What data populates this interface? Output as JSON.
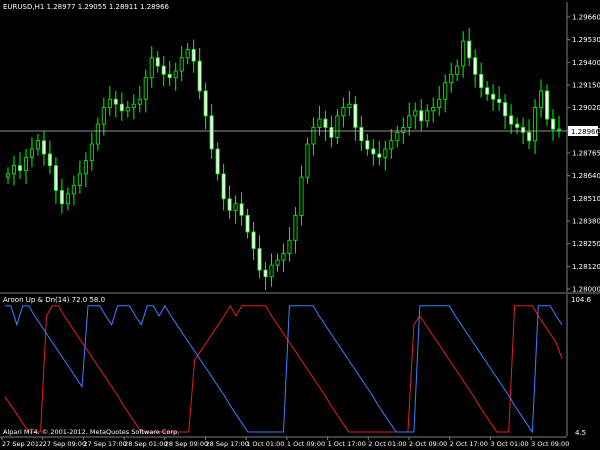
{
  "header": {
    "symbol_info": "EURUSD,H1  1.28977 1.29055 1.28911 1.28966"
  },
  "price_axis": {
    "labels": [
      "1.29660",
      "1.29530",
      "1.29400",
      "1.29150",
      "1.29020",
      "1.28890",
      "1.28765",
      "1.28640",
      "1.28510",
      "1.28380",
      "1.28250",
      "1.28120",
      "1.28000"
    ],
    "current_price": "1.28966"
  },
  "indicator": {
    "title": "Aroon Up & Dn(14) 72.0 58.0",
    "axis_top": "104.6",
    "axis_bottom": "4.5",
    "up_color": "#3e7fff",
    "down_color": "#e02020"
  },
  "time_axis": {
    "labels": [
      "27 Sep 2012",
      "27 Sep 09:00",
      "27 Sep 17:00",
      "28 Sep 01:00",
      "28 Sep 09:00",
      "28 Sep 17:00",
      "1 Oct 01:00",
      "1 Oct 09:00",
      "1 Oct 17:00",
      "2 Oct 01:00",
      "2 Oct 09:00",
      "2 Oct 17:00",
      "3 Oct 01:00",
      "3 Oct 09:00"
    ]
  },
  "footer": {
    "copyright": "Alpari MT4, © 2001-2012, MetaQuotes Software Corp."
  },
  "colors": {
    "background": "#000000",
    "candle": "#00ff00",
    "bull_fill": "#000000",
    "bear_fill": "#ffffff",
    "axis": "#808080",
    "text": "#ffffff"
  },
  "chart_data": [
    {
      "type": "candlestick",
      "title": "EURUSD,H1",
      "ylim": [
        1.28,
        1.297
      ],
      "close": [
        1.287,
        1.2875,
        1.2872,
        1.288,
        1.2885,
        1.289,
        1.2882,
        1.2875,
        1.286,
        1.2852,
        1.2858,
        1.2863,
        1.287,
        1.2878,
        1.2888,
        1.29,
        1.291,
        1.2915,
        1.2912,
        1.2908,
        1.291,
        1.2912,
        1.2915,
        1.2928,
        1.294,
        1.2935,
        1.293,
        1.2928,
        1.2932,
        1.294,
        1.2945,
        1.2938,
        1.292,
        1.2905,
        1.2885,
        1.287,
        1.2855,
        1.2848,
        1.2852,
        1.2845,
        1.2835,
        1.2825,
        1.2812,
        1.2808,
        1.2815,
        1.2818,
        1.2822,
        1.283,
        1.2845,
        1.2868,
        1.2888,
        1.2898,
        1.2903,
        1.2898,
        1.2892,
        1.2905,
        1.291,
        1.2912,
        1.2898,
        1.289,
        1.2885,
        1.2882,
        1.288,
        1.2885,
        1.289,
        1.2895,
        1.2898,
        1.2905,
        1.2908,
        1.2902,
        1.2908,
        1.291,
        1.2915,
        1.2925,
        1.293,
        1.2935,
        1.295,
        1.294,
        1.293,
        1.2922,
        1.2918,
        1.2915,
        1.2913,
        1.2905,
        1.29,
        1.2898,
        1.2895,
        1.289,
        1.291,
        1.292,
        1.2903,
        1.2897,
        1.2897
      ],
      "open": [
        1.2868,
        1.287,
        1.2875,
        1.2872,
        1.288,
        1.2885,
        1.289,
        1.2882,
        1.2875,
        1.286,
        1.2852,
        1.2858,
        1.2863,
        1.287,
        1.2878,
        1.2888,
        1.29,
        1.291,
        1.2915,
        1.2912,
        1.2908,
        1.291,
        1.2912,
        1.2915,
        1.2928,
        1.294,
        1.2935,
        1.293,
        1.2928,
        1.2932,
        1.294,
        1.2945,
        1.2938,
        1.292,
        1.2905,
        1.2885,
        1.287,
        1.2855,
        1.2848,
        1.2852,
        1.2845,
        1.2835,
        1.2825,
        1.2812,
        1.2808,
        1.2815,
        1.2818,
        1.2822,
        1.283,
        1.2845,
        1.2868,
        1.2888,
        1.2898,
        1.2903,
        1.2898,
        1.2892,
        1.2905,
        1.291,
        1.2912,
        1.2898,
        1.289,
        1.2885,
        1.2882,
        1.288,
        1.2885,
        1.289,
        1.2895,
        1.2898,
        1.2905,
        1.2908,
        1.2902,
        1.2908,
        1.291,
        1.2915,
        1.2925,
        1.293,
        1.2935,
        1.295,
        1.294,
        1.293,
        1.2922,
        1.2918,
        1.2915,
        1.2913,
        1.2905,
        1.29,
        1.2898,
        1.2895,
        1.289,
        1.291,
        1.292,
        1.2903,
        1.2897
      ]
    },
    {
      "type": "line",
      "title": "Aroon Up & Dn(14) 72.0 58.0",
      "ylim": [
        0,
        104.6
      ],
      "series": [
        {
          "name": "Aroon Up",
          "values": [
            100,
            100,
            85,
            100,
            100,
            92,
            85,
            78,
            71,
            64,
            57,
            50,
            43,
            36,
            100,
            100,
            100,
            92,
            85,
            100,
            100,
            100,
            92,
            85,
            100,
            100,
            92,
            100,
            92,
            85,
            78,
            71,
            64,
            57,
            50,
            43,
            36,
            29,
            21,
            14,
            7,
            0,
            0,
            0,
            0,
            0,
            0,
            0,
            100,
            100,
            100,
            100,
            100,
            92,
            85,
            78,
            71,
            64,
            57,
            50,
            43,
            36,
            29,
            21,
            14,
            7,
            0,
            0,
            0,
            0,
            100,
            100,
            100,
            100,
            100,
            100,
            92,
            85,
            78,
            71,
            64,
            57,
            50,
            43,
            36,
            29,
            21,
            14,
            7,
            0,
            100,
            100,
            100,
            92,
            85
          ]
        },
        {
          "name": "Aroon Dn",
          "values": [
            28,
            21,
            14,
            7,
            0,
            0,
            0,
            92,
            100,
            100,
            92,
            85,
            78,
            71,
            64,
            57,
            50,
            43,
            36,
            29,
            21,
            14,
            7,
            0,
            0,
            0,
            0,
            0,
            0,
            0,
            0,
            0,
            57,
            64,
            71,
            78,
            85,
            92,
            100,
            92,
            100,
            100,
            100,
            100,
            100,
            92,
            85,
            78,
            71,
            64,
            57,
            50,
            43,
            36,
            29,
            21,
            14,
            7,
            0,
            0,
            0,
            0,
            0,
            0,
            0,
            0,
            0,
            0,
            0,
            85,
            92,
            85,
            78,
            71,
            64,
            57,
            50,
            43,
            36,
            29,
            21,
            14,
            7,
            0,
            0,
            0,
            100,
            100,
            100,
            100,
            92,
            85,
            78,
            71,
            58
          ]
        }
      ]
    }
  ]
}
